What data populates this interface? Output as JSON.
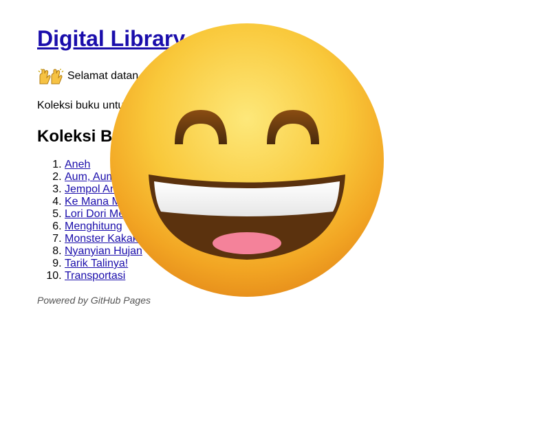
{
  "header": {
    "title": "Digital Library"
  },
  "welcome": {
    "text": "Selamat datan",
    "icon": "raising-hands-icon"
  },
  "description": "Koleksi buku untu",
  "section": {
    "title": "Koleksi B"
  },
  "books": [
    {
      "label": "Aneh"
    },
    {
      "label": "Aum, Aum"
    },
    {
      "label": "Jempol An"
    },
    {
      "label": "Ke Mana M"
    },
    {
      "label": "Lori Dori Me"
    },
    {
      "label": "Menghitung"
    },
    {
      "label": "Monster Kakak"
    },
    {
      "label": "Nyanyian Hujan"
    },
    {
      "label": "Tarik Talinya!"
    },
    {
      "label": "Transportasi"
    }
  ],
  "footer": {
    "powered": "Powered by GitHub Pages"
  },
  "overlay": {
    "icon": "grinning-face-with-smiling-eyes-icon"
  }
}
